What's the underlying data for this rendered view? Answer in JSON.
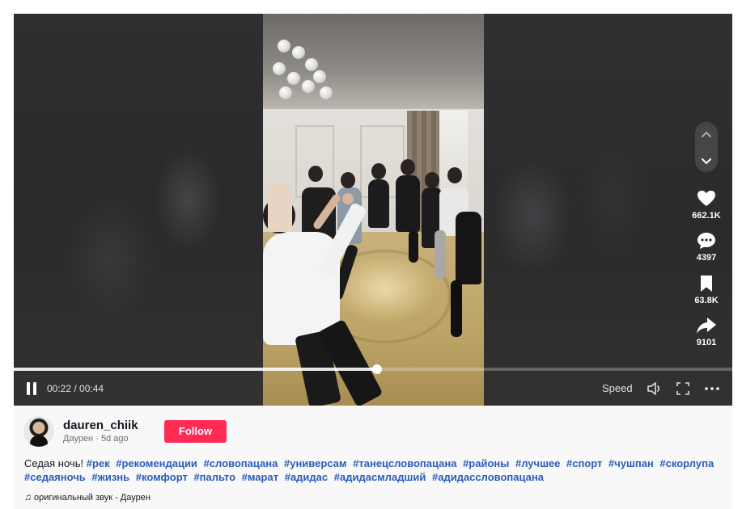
{
  "player": {
    "time": "00:22 / 00:44",
    "progress": 0.506,
    "speed_label": "Speed",
    "state": "playing"
  },
  "actions": {
    "likes": "662.1K",
    "comments": "4397",
    "saves": "63.8K",
    "shares": "9101"
  },
  "author": {
    "username": "dauren_chiik",
    "display_name": "Даурен",
    "posted": "5d ago",
    "follow_label": "Follow"
  },
  "caption": {
    "text": "Седая ночь!",
    "hashtags": [
      "#рек",
      "#рекомендации",
      "#словопацана",
      "#универсам",
      "#танецсловопацана",
      "#районы",
      "#лучшее",
      "#спорт",
      "#чушпан",
      "#скорлупа",
      "#седаяночь",
      "#жизнь",
      "#комфорт",
      "#пальто",
      "#марат",
      "#адидас",
      "#адидасмладший",
      "#адидассловопацана"
    ]
  },
  "sound": {
    "label": "оригинальный звук - Даурен"
  },
  "icons": {
    "pause": "pause-icon",
    "volume": "volume-icon",
    "fullscreen": "fullscreen-icon",
    "more": "more-icon",
    "up": "chevron-up-icon",
    "down": "chevron-down-icon",
    "like": "heart-icon",
    "comment": "comment-icon",
    "save": "bookmark-icon",
    "share": "share-icon",
    "music": "music-note-icon"
  },
  "colors": {
    "follow": "#fe2c55",
    "hashtag": "#2b5db8"
  }
}
